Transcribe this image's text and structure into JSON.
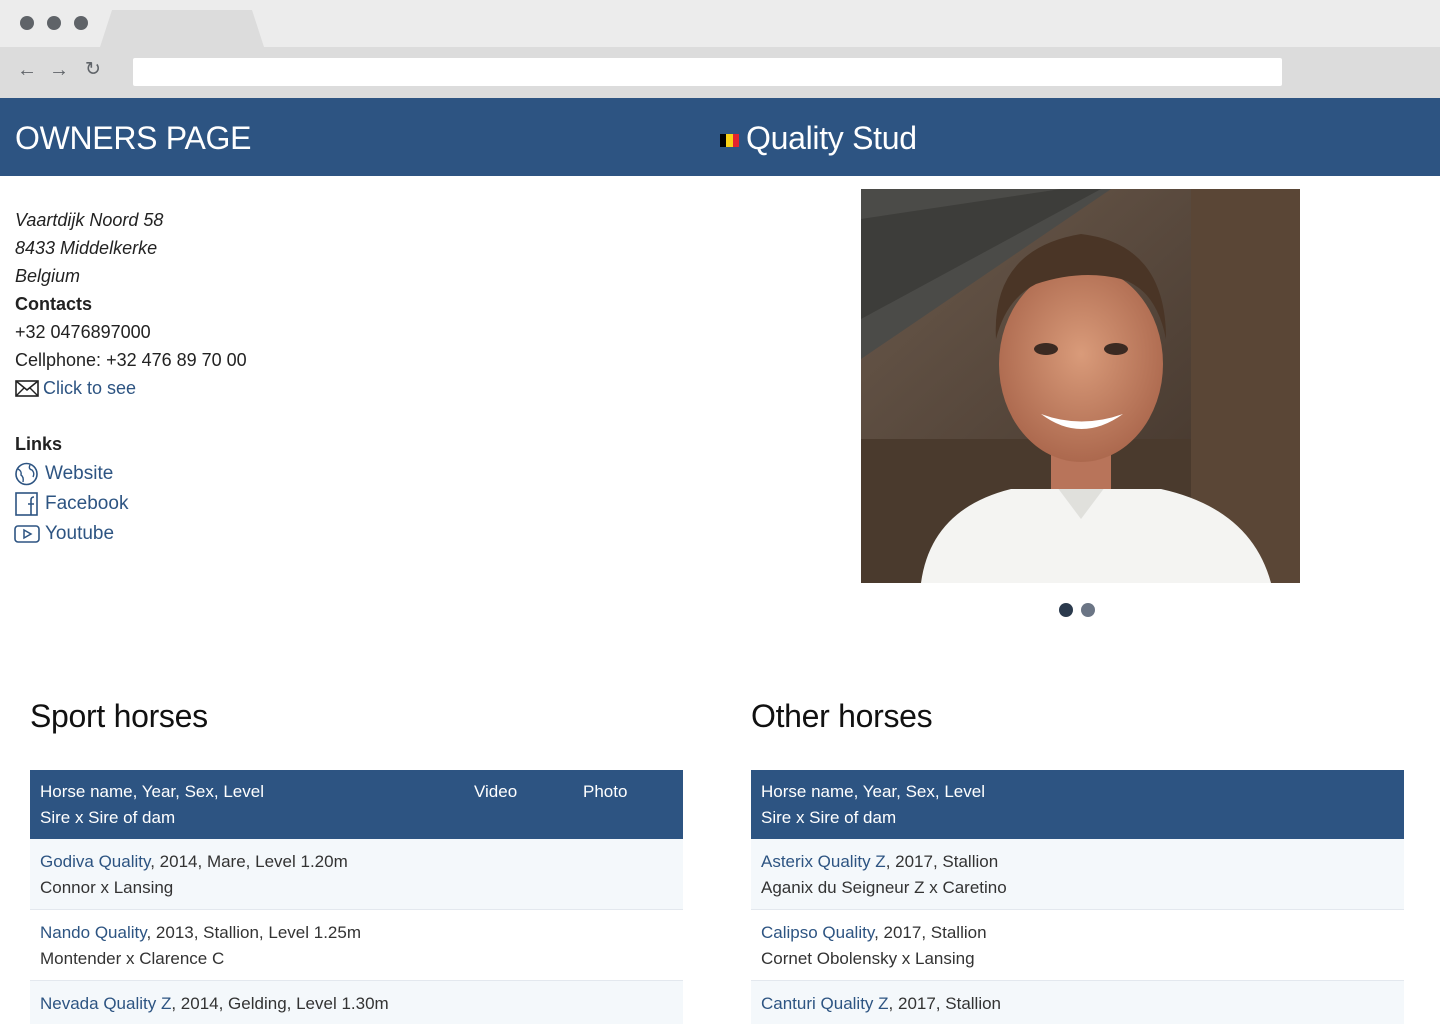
{
  "browser": {
    "url": "",
    "back_icon": "←",
    "forward_icon": "→",
    "reload_icon": "↻"
  },
  "header": {
    "title": "OWNERS PAGE",
    "stud_name": "Quality Stud",
    "flag_colors": [
      "#000000",
      "#f7d117",
      "#e3232d"
    ],
    "background": "#2d5482"
  },
  "address": {
    "street": "Vaartdijk Noord 58",
    "city": "8433 Middelkerke",
    "country": "Belgium"
  },
  "contacts": {
    "title": "Contacts",
    "phone": "+32 0476897000",
    "cellphone": "Cellphone: +32 476 89 70 00",
    "email_link": "Click to see"
  },
  "links": {
    "title": "Links",
    "items": [
      {
        "label": "Website",
        "icon": "globe-icon"
      },
      {
        "label": "Facebook",
        "icon": "facebook-icon"
      },
      {
        "label": "Youtube",
        "icon": "youtube-icon"
      }
    ]
  },
  "carousel": {
    "slides": 2,
    "active": 1
  },
  "sport_horses": {
    "title": "Sport horses",
    "header_line1": "Horse name, Year, Sex, Level",
    "header_line2": "Sire x Sire of dam",
    "video_label": "Video",
    "photo_label": "Photo",
    "rows": [
      {
        "name": "Godiva Quality",
        "details": ", 2014, Mare, Level 1.20m",
        "pedigree": "Connor x Lansing"
      },
      {
        "name": "Nando Quality",
        "details": ", 2013, Stallion, Level 1.25m",
        "pedigree": "Montender x Clarence C"
      },
      {
        "name": "Nevada Quality Z",
        "details": ", 2014, Gelding, Level 1.30m",
        "pedigree": ""
      }
    ]
  },
  "other_horses": {
    "title": "Other horses",
    "header_line1": "Horse name, Year, Sex, Level",
    "header_line2": "Sire x Sire of dam",
    "rows": [
      {
        "name": "Asterix Quality Z",
        "details": ", 2017, Stallion",
        "pedigree": "Aganix du Seigneur Z x Caretino"
      },
      {
        "name": "Calipso Quality",
        "details": ", 2017, Stallion",
        "pedigree": "Cornet Obolensky x Lansing"
      },
      {
        "name": "Canturi Quality Z",
        "details": ", 2017, Stallion",
        "pedigree": ""
      }
    ]
  }
}
